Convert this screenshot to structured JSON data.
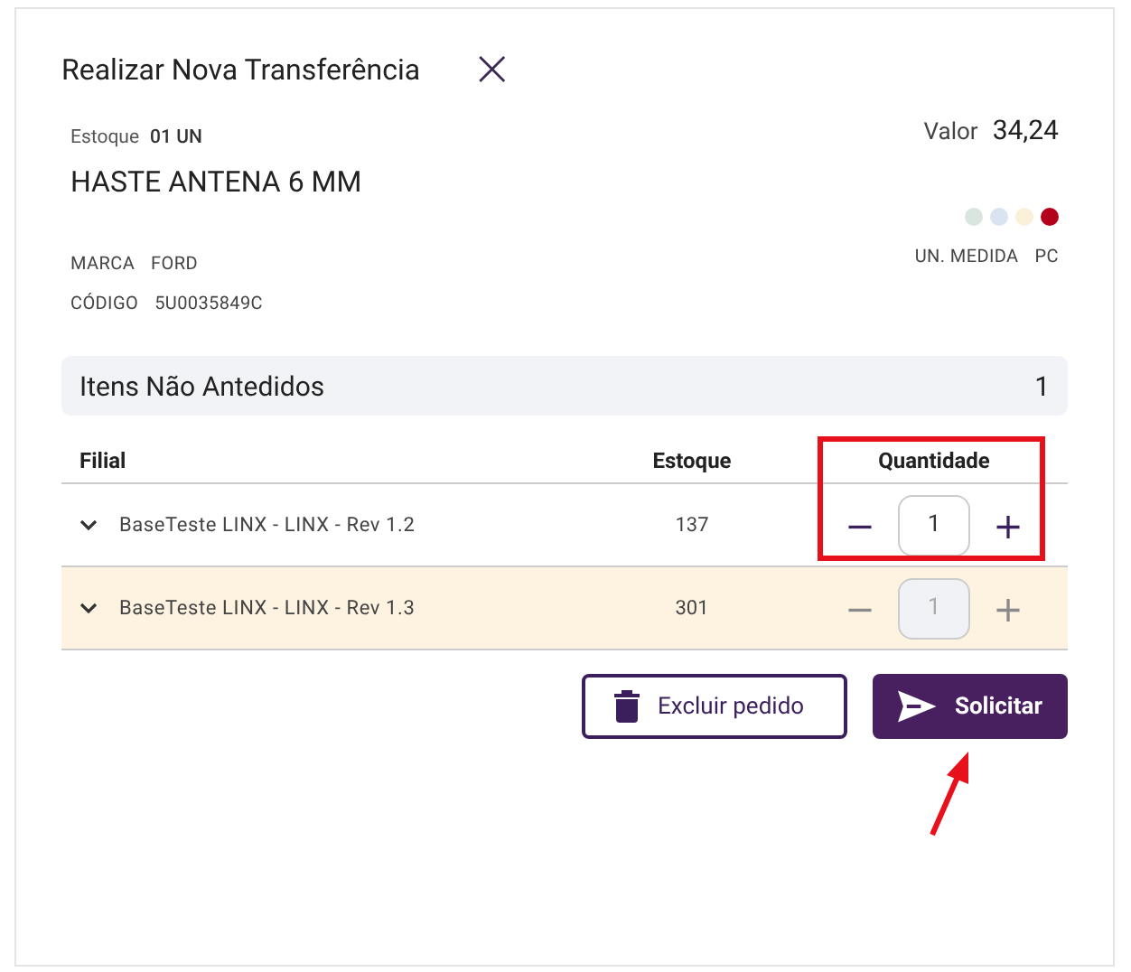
{
  "dialog": {
    "title": "Realizar Nova Transferência",
    "close": "×"
  },
  "product": {
    "stock_label": "Estoque",
    "stock_value": "01 UN",
    "name": "HASTE ANTENA 6 MM",
    "price_label": "Valor",
    "price": "34,24",
    "colors": [
      {
        "color": "#d9e6e0"
      },
      {
        "color": "#d9e3f2"
      },
      {
        "color": "#fbf1d9"
      },
      {
        "color": "#b3001b"
      }
    ],
    "brand_label": "MARCA",
    "brand": "FORD",
    "code_label": "CÓDIGO",
    "code": "5U0035849C",
    "unit_label": "UN. MEDIDA",
    "unit": "PC"
  },
  "section": {
    "title": "Itens Não Antedidos",
    "count": "1"
  },
  "table": {
    "columns": [
      "Filial",
      "Estoque",
      "Quantidade"
    ],
    "rows": [
      {
        "filial": "BaseTeste LINX - LINX - Rev 1.2",
        "estoque": "137",
        "quantidade": "1",
        "minus": "−",
        "plus": "+",
        "selected": false,
        "disabled": false
      },
      {
        "filial": "BaseTeste LINX - LINX - Rev 1.3",
        "estoque": "301",
        "quantidade": "1",
        "minus": "−",
        "plus": "+",
        "selected": true,
        "disabled": true
      }
    ]
  },
  "buttons": [
    {
      "kind": "delete",
      "label": "Excluir pedido"
    },
    {
      "kind": "send",
      "label": "Solicitar"
    }
  ]
}
